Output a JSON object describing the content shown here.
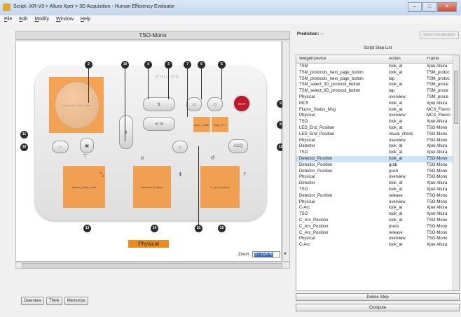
{
  "window": {
    "title": "Script: iXR-V3 > Allura Xper > 3D Acquisition - Human Efficiency Evaluator",
    "controls": [
      "–",
      "□",
      "✕"
    ]
  },
  "menu": [
    "File",
    "Edit",
    "Modify",
    "Window",
    "Help"
  ],
  "left_panel": {
    "title": "TSO-Mono",
    "device": {
      "brand": "PHILIPS",
      "regions": [
        {
          "label": "Horizontal_Table_Joint"
        },
        {
          "label": "Lateral_Table_Joint"
        },
        {
          "label": "Detector_Position"
        },
        {
          "label": "C_Arc_Position"
        },
        {
          "label": "Auto_Crash"
        },
        {
          "label": "Stop_CTL"
        }
      ],
      "callouts": [
        "2",
        "10",
        "4",
        "3",
        "7",
        "5",
        "6",
        "9",
        "8",
        "11",
        "10",
        "12",
        "13",
        "14",
        "31",
        "15"
      ],
      "buttons": {
        "stop": "STOP",
        "acq": "ACQ"
      }
    },
    "footer_label": "Physical",
    "zoom_label": "Zoom:",
    "zoom_value": "57.024 %"
  },
  "bottom_buttons": [
    "Overview",
    "Think",
    "Memorize"
  ],
  "right_panel": {
    "prediction_label": "Prediction:",
    "prediction_value": "---",
    "show_visualization": "Show Visualization",
    "list_title": "Script Step List",
    "columns": [
      "Widget/Device",
      "Action",
      "Frame"
    ],
    "rows": [
      [
        "TSM",
        "look_at",
        "Xper Allura"
      ],
      [
        "TSM_protocols_next_page_button",
        "look_at",
        "TSM_protoc"
      ],
      [
        "TSM_protocols_next_page_button",
        "tap",
        "TSM_protoc"
      ],
      [
        "TSM_select_3D_protocol_button",
        "look_at",
        "TSM_proce"
      ],
      [
        "TSM_select_3D_protocol_button",
        "tap",
        "TSM_proce"
      ],
      [
        "Physical",
        "overview",
        "TSM_proce"
      ],
      [
        "MCS",
        "look_at",
        "Xper Allura"
      ],
      [
        "Fluoro_Status_Msg",
        "look_at",
        "MCS_Fluoro"
      ],
      [
        "Physical",
        "overview",
        "MCS_Fluoro"
      ],
      [
        "TSO",
        "look_at",
        "Xper Allura"
      ],
      [
        "LED_End_Position",
        "look_at",
        "TSO-Mono"
      ],
      [
        "LED_End_Position",
        "visual_check",
        "TSO-Mono"
      ],
      [
        "Physical",
        "overview",
        "TSO-Mono"
      ],
      [
        "Detector",
        "look_at",
        "Xper Allura"
      ],
      [
        "TSO",
        "look_at",
        "Xper Allura"
      ],
      [
        "Detector_Position",
        "look_at",
        "TSO-Mono"
      ],
      [
        "Detector_Position",
        "grab",
        "TSO-Mono"
      ],
      [
        "Detector_Position",
        "push",
        "TSO-Mono"
      ],
      [
        "Physical",
        "overview",
        "TSO-Mono"
      ],
      [
        "Detector",
        "look_at",
        "Xper Allura"
      ],
      [
        "TSO",
        "look_at",
        "Xper Allura"
      ],
      [
        "Detector_Position",
        "release",
        "TSO-Mono"
      ],
      [
        "Physical",
        "overview",
        "TSO-Mono"
      ],
      [
        "C-Arc",
        "look_at",
        "Xper Allura"
      ],
      [
        "TSO",
        "look_at",
        "Xper Allura"
      ],
      [
        "C_Arc_Position",
        "look_at",
        "TSO-Mono"
      ],
      [
        "C_Arc_Position",
        "press",
        "TSO-Mono"
      ],
      [
        "C_Arc_Position",
        "release",
        "TSO-Mono"
      ],
      [
        "Physical",
        "overview",
        "TSO-Mono"
      ],
      [
        "C-Arc",
        "look_at",
        "Xper Allura"
      ]
    ],
    "selected_row": 15,
    "delete_step": "Delete Step",
    "compute": "Compute"
  }
}
